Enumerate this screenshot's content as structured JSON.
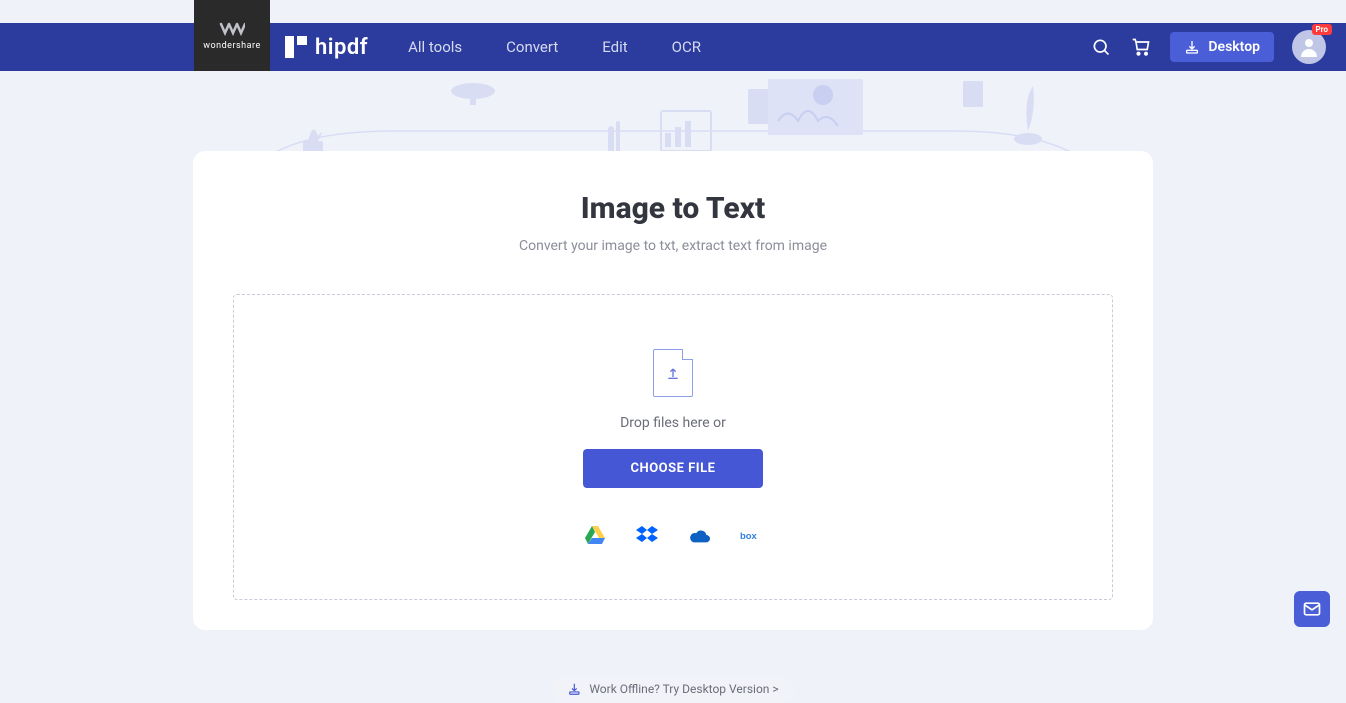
{
  "brand": {
    "parent": "wondershare",
    "product": "hipdf"
  },
  "nav": {
    "links": [
      "All tools",
      "Convert",
      "Edit",
      "OCR"
    ],
    "desktop_label": "Desktop",
    "pro_badge": "Pro"
  },
  "page": {
    "title": "Image to Text",
    "subtitle": "Convert your image to txt, extract text from image"
  },
  "dropzone": {
    "drop_text": "Drop files here or",
    "choose_label": "CHOOSE FILE"
  },
  "cloud_sources": [
    "google-drive",
    "dropbox",
    "onedrive",
    "box"
  ],
  "offline_cta": "Work Offline? Try Desktop Version >",
  "colors": {
    "primary": "#4557d4",
    "navbar": "#2c3b9e"
  }
}
